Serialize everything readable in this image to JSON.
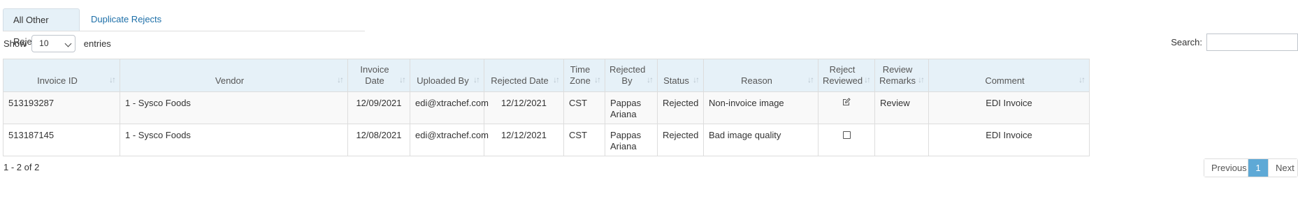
{
  "tabs": [
    {
      "label": "All Other Rejects",
      "active": true
    },
    {
      "label": "Duplicate Rejects",
      "active": false
    }
  ],
  "length_control": {
    "prefix": "Show",
    "selected": "10",
    "suffix": "entries"
  },
  "search": {
    "label": "Search:",
    "value": ""
  },
  "table": {
    "headers": {
      "invoice_id": "Invoice ID",
      "vendor": "Vendor",
      "invoice_date": "Invoice Date",
      "uploaded_by": "Uploaded By",
      "rejected_date": "Rejected Date",
      "time_zone": "Time Zone",
      "rejected_by": "Rejected By",
      "status": "Status",
      "reason": "Reason",
      "reject_reviewed": "Reject Reviewed",
      "review_remarks": "Review Remarks",
      "comment": "Comment"
    },
    "sort_icon": "↓↑",
    "rows": [
      {
        "invoice_id": "513193287",
        "vendor": "1 - Sysco Foods",
        "invoice_date": "12/09/2021",
        "uploaded_by": "edi@xtrachef.com",
        "rejected_date": "12/12/2021",
        "time_zone": "CST",
        "rejected_by": "Pappas Ariana",
        "status": "Rejected",
        "reason": "Non-invoice image",
        "reject_reviewed_icon": "edit-icon",
        "review_remarks": "Review",
        "comment": "EDI Invoice"
      },
      {
        "invoice_id": "513187145",
        "vendor": "1 - Sysco Foods",
        "invoice_date": "12/08/2021",
        "uploaded_by": "edi@xtrachef.com",
        "rejected_date": "12/12/2021",
        "time_zone": "CST",
        "rejected_by": "Pappas Ariana",
        "status": "Rejected",
        "reason": "Bad image quality",
        "reject_reviewed_icon": "checkbox-icon",
        "review_remarks": "",
        "comment": "EDI Invoice"
      }
    ]
  },
  "info": "1 - 2 of 2",
  "pagination": {
    "previous": "Previous",
    "current": "1",
    "next": "Next"
  },
  "colors": {
    "header_bg": "#e6f1f8",
    "link": "#1d6fa8",
    "active_page": "#5ea9d6"
  }
}
